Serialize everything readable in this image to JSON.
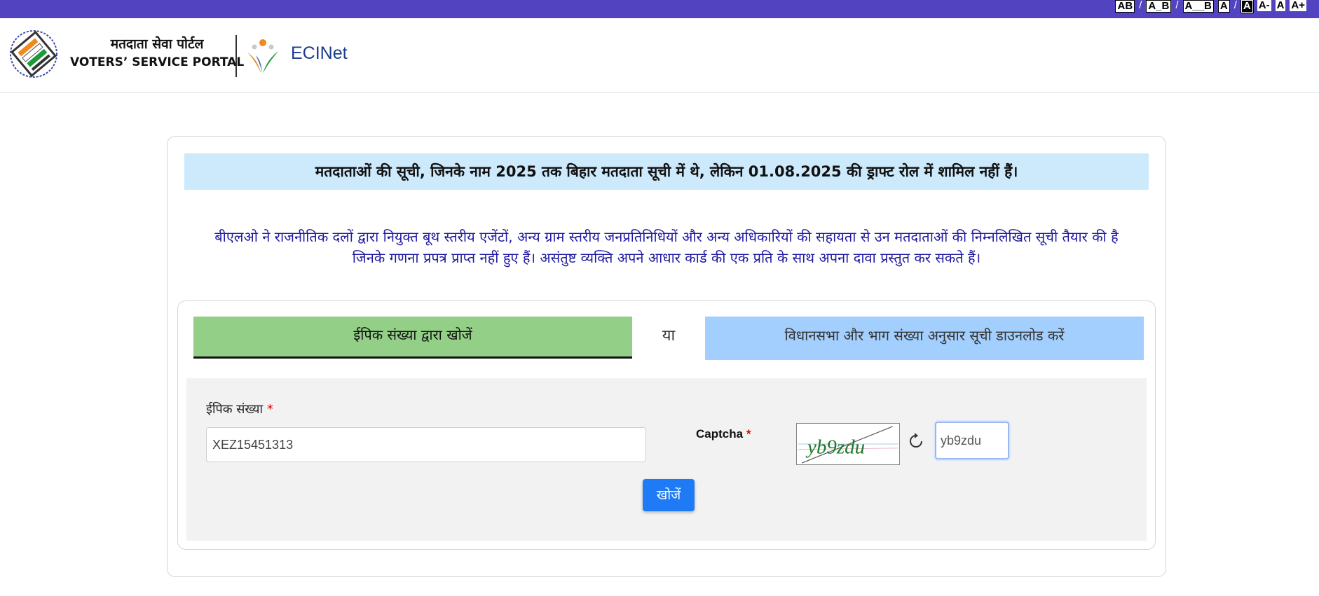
{
  "accessibility": {
    "items": [
      "AB",
      "/",
      "A_B",
      "/",
      "A__B",
      "A",
      "/",
      "A",
      "A-",
      "A",
      "A+"
    ]
  },
  "header": {
    "portal_name_hi": "मतदाता सेवा पोर्टल",
    "portal_name_en": "VOTERS’ SERVICE PORTAL",
    "ecinet": "ECINet"
  },
  "notice": {
    "title": "मतदाताओं की सूची, जिनके नाम 2025 तक बिहार मतदाता सूची में थे, लेकिन 01.08.2025 की ड्राफ्ट रोल में शामिल नहीं हैं।",
    "description_line1": "बीएलओ ने राजनीतिक दलों द्वारा नियुक्त बूथ स्तरीय एजेंटों, अन्य ग्राम स्तरीय जनप्रतिनिधियों और अन्य अधिकारियों की सहायता से उन मतदाताओं की निम्नलिखित सूची तैयार की है",
    "description_line2": "जिनके गणना प्रपत्र प्राप्त नहीं हुए हैं। असंतुष्ट व्यक्ति अपने आधार कार्ड की एक प्रति के साथ अपना दावा प्रस्तुत कर सकते हैं।"
  },
  "tabs": {
    "epic": "ईपिक संख्या द्वारा खोजें",
    "or": "या",
    "assembly": "विधानसभा और भाग संख्या अनुसार सूची डाउनलोड करें"
  },
  "form": {
    "epic_label": "ईपिक संख्या",
    "required_mark": "*",
    "epic_value": "XEZ15451313",
    "captcha_label": "Captcha",
    "captcha_image_text": "yb9zdu",
    "captcha_value": "yb9zdu",
    "search_button": "खोजें"
  },
  "colors": {
    "topbar": "#5244c0",
    "notice_bg": "#cdeafd",
    "notice_text": "#1f1aa0",
    "tab_epic": "#93cf87",
    "tab_assembly": "#a2cffd",
    "search_button": "#1e7bf5"
  }
}
